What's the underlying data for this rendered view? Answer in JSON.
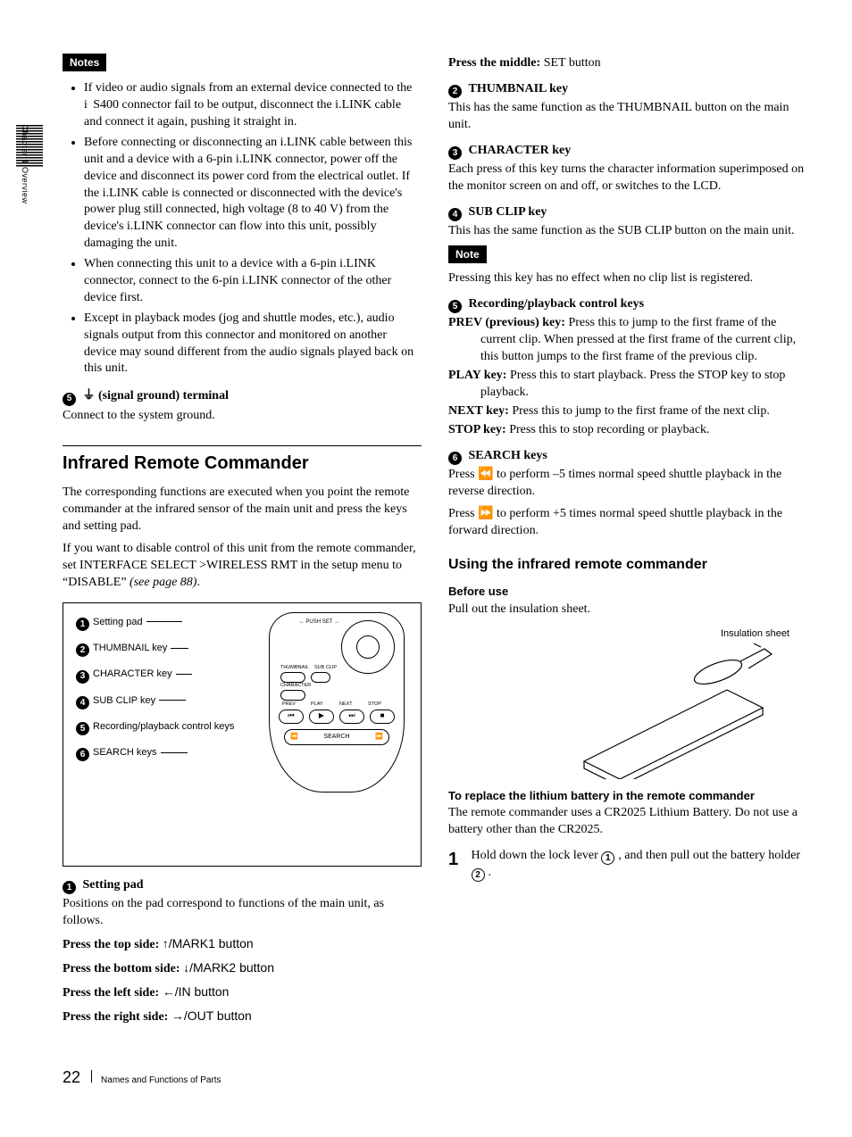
{
  "side_tab": "Chapter 1  Overview",
  "left": {
    "notes_label": "Notes",
    "bullets": [
      "If video or audio signals from an external device connected to the  i  S400 connector fail to be output, disconnect the i.LINK cable and connect it again, pushing it straight in.",
      "Before connecting or disconnecting an i.LINK cable between this unit and a device with a 6-pin i.LINK connector, power off the device and disconnect its power cord from the electrical outlet. If the i.LINK cable is connected or disconnected with the device's power plug still connected, high voltage (8 to 40 V) from the device's i.LINK connector can flow into this unit, possibly damaging the unit.",
      "When connecting this unit to a device with a 6-pin i.LINK connector, connect to the 6-pin i.LINK connector of the other device first.",
      "Except in playback modes (jog and shuttle modes, etc.), audio signals output from this connector and monitored on another device may sound different from the audio signals played back on this unit."
    ],
    "item5_num": "5",
    "item5_title": "⏚ (signal ground) terminal",
    "item5_text": "Connect to the system ground.",
    "section_title": "Infrared Remote Commander",
    "intro1": "The corresponding functions are executed when you point the remote commander at the infrared sensor of the main unit and press the keys and setting pad.",
    "intro2_a": "If you want to disable control of this unit from the remote commander, set INTERFACE SELECT >WIRELESS RMT in the setup menu to “DISABLE” ",
    "intro2_ref": "(see page 88)",
    "intro2_b": ".",
    "diagram": {
      "l1": "Setting pad",
      "l2": "THUMBNAIL key",
      "l3": "CHARACTER key",
      "l4": "SUB CLIP key",
      "l5": "Recording/playback control keys",
      "l6": "SEARCH keys",
      "padtext": "← PUSH SET →",
      "thumb": "THUMBNAIL",
      "subclip": "SUB CLIP",
      "char": "CHARACTER",
      "prev": "PREV",
      "play": "PLAY",
      "next": "NEXT",
      "stop": "STOP",
      "search": "SEARCH",
      "prev_g": "⏮",
      "play_g": "▶",
      "next_g": "⏭",
      "stop_g": "■",
      "rw_g": "⏪",
      "ff_g": "⏩"
    },
    "item1_num": "1",
    "item1_title": "Setting pad",
    "item1_text": "Positions on the pad correspond to functions of the main unit, as follows.",
    "press_top_l": "Press the top side: ",
    "press_top_v": "↑/MARK1 button",
    "press_bot_l": "Press the bottom side: ",
    "press_bot_v": "↓/MARK2 button",
    "press_left_l": "Press the left side: ",
    "press_left_v": "←/IN button",
    "press_right_l": "Press the right side: ",
    "press_right_v": "→/OUT button"
  },
  "right": {
    "press_mid_l": "Press the middle: ",
    "press_mid_v": "SET button",
    "i2_num": "2",
    "i2_title": "THUMBNAIL key",
    "i2_text": "This has the same function as the THUMBNAIL button on the main unit.",
    "i3_num": "3",
    "i3_title": "CHARACTER key",
    "i3_text": "Each press of this key turns the character information superimposed on the monitor screen on and off, or switches to the LCD.",
    "i4_num": "4",
    "i4_title": "SUB CLIP key",
    "i4_text": "This has the same function as the SUB CLIP button on the main unit.",
    "note_label": "Note",
    "note_text": "Pressing this key has no effect when no clip list is registered.",
    "i5_num": "5",
    "i5_title": "Recording/playback control keys",
    "prev_l": "PREV (previous) key: ",
    "prev_t": "Press this to jump to the first frame of the current clip. When pressed at the first frame of the current clip, this button jumps to the first frame of the previous clip.",
    "play_l": "PLAY key: ",
    "play_t": "Press this to start playback. Press the STOP key to stop playback.",
    "next_l": "NEXT key: ",
    "next_t": "Press this to jump to the first frame of the next clip.",
    "stop_l": "STOP key: ",
    "stop_t": "Press this to stop recording or playback.",
    "i6_num": "6",
    "i6_title": "SEARCH keys",
    "search_a": "Press ⏪ to perform –5 times normal speed shuttle playback in the reverse direction.",
    "search_b": "Press ⏩ to perform +5 times normal speed shuttle playback in the forward direction.",
    "using_title": "Using the infrared remote commander",
    "before_title": "Before use",
    "before_text": "Pull out the insulation sheet.",
    "insulation_label": "Insulation sheet",
    "replace_title": "To replace the lithium battery in the remote commander",
    "replace_text": "The remote commander uses a CR2025 Lithium Battery. Do not use a battery other than the CR2025.",
    "step1_num": "1",
    "step1_a": "Hold down the lock lever ",
    "step1_c1": "1",
    "step1_b": ", and then pull out the battery holder ",
    "step1_c2": "2",
    "step1_c": "."
  },
  "footer": {
    "page": "22",
    "title": "Names and Functions of Parts"
  }
}
